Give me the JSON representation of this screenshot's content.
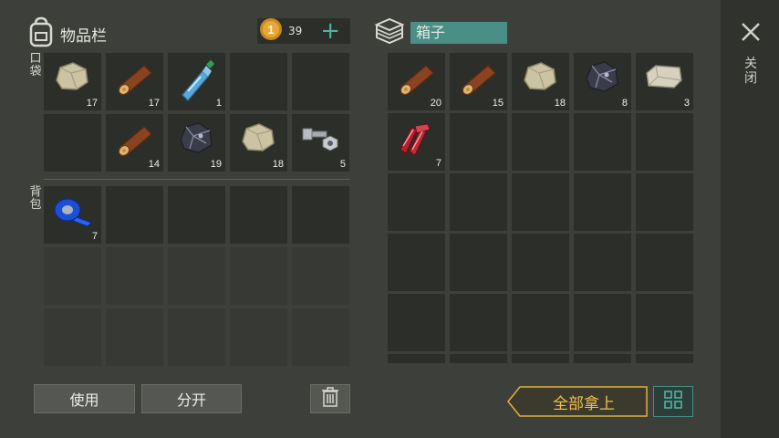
{
  "inventory": {
    "title": "物品栏",
    "coins": "39",
    "pockets_label": "口袋",
    "backpack_label": "背包",
    "pockets": [
      {
        "item": "stone-icon",
        "count": "17"
      },
      {
        "item": "wood-log-icon",
        "count": "17"
      },
      {
        "item": "water-bottle-icon",
        "count": "1"
      },
      {
        "item": "",
        "count": ""
      },
      {
        "item": "",
        "count": ""
      },
      {
        "item": "",
        "count": ""
      },
      {
        "item": "wood-log-icon",
        "count": "14"
      },
      {
        "item": "iron-ore-icon",
        "count": "19"
      },
      {
        "item": "stone-icon",
        "count": "18"
      },
      {
        "item": "nuts-bolts-icon",
        "count": "5"
      }
    ],
    "backpack": [
      {
        "item": "blue-tape-icon",
        "count": "7"
      }
    ]
  },
  "box": {
    "title": "箱子",
    "slots": [
      {
        "item": "wood-log-icon",
        "count": "20"
      },
      {
        "item": "wood-log-icon",
        "count": "15"
      },
      {
        "item": "stone-icon",
        "count": "18"
      },
      {
        "item": "iron-ore-icon",
        "count": "8"
      },
      {
        "item": "limestone-icon",
        "count": "3"
      },
      {
        "item": "raw-meat-icon",
        "count": "7"
      }
    ]
  },
  "buttons": {
    "use": "使用",
    "split": "分开",
    "take_all": "全部拿上",
    "close": "关闭"
  },
  "colors": {
    "accent_teal": "#4a8f86",
    "take_all_gold": "#e2b23c"
  }
}
